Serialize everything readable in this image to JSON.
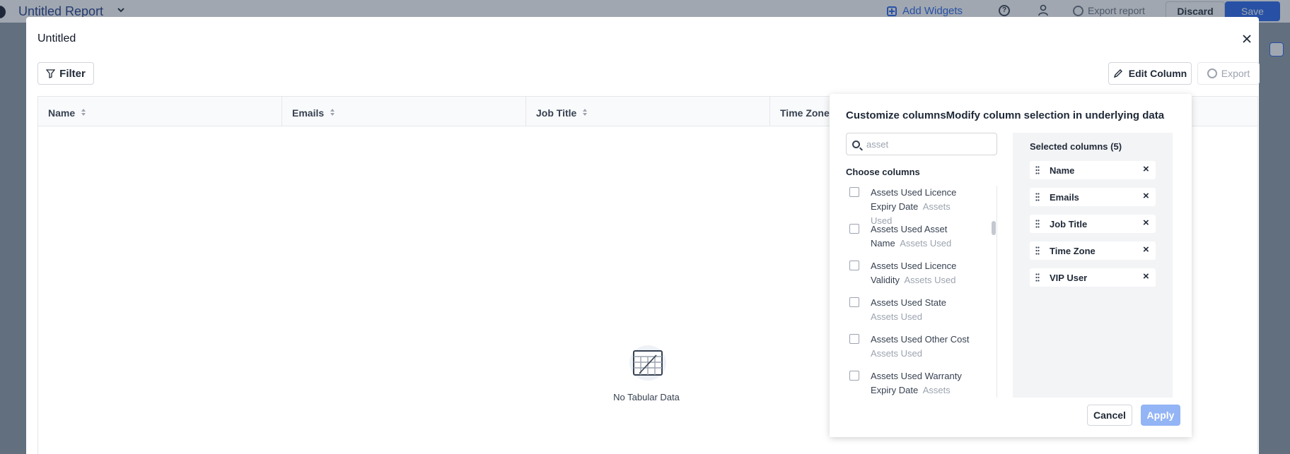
{
  "topbar": {
    "report_title": "Untitled Report",
    "add_widgets": "Add Widgets",
    "export_report": "Export report",
    "discard": "Discard",
    "save": "Save"
  },
  "dialog": {
    "title": "Untitled",
    "filter_label": "Filter",
    "edit_column_label": "Edit Column",
    "export_label": "Export",
    "columns": [
      "Name",
      "Emails",
      "Job Title",
      "Time Zone"
    ],
    "empty_text": "No Tabular Data"
  },
  "customize": {
    "title": "Customize columnsModify column selection in underlying data",
    "search_value": "",
    "search_placeholder": "asset",
    "choose_label": "Choose columns",
    "options": [
      {
        "label": "Assets Used Licence Expiry Date",
        "group": "Assets Used"
      },
      {
        "label": "Assets Used Asset Name",
        "group": "Assets Used"
      },
      {
        "label": "Assets Used Licence Validity",
        "group": "Assets Used"
      },
      {
        "label": "Assets Used State",
        "group": "Assets Used"
      },
      {
        "label": "Assets Used Other Cost",
        "group": "Assets Used"
      },
      {
        "label": "Assets Used Warranty Expiry Date",
        "group": "Assets Used"
      }
    ],
    "selected_title": "Selected columns (5)",
    "selected": [
      "Name",
      "Emails",
      "Job Title",
      "Time Zone",
      "VIP User"
    ],
    "cancel": "Cancel",
    "apply": "Apply"
  }
}
